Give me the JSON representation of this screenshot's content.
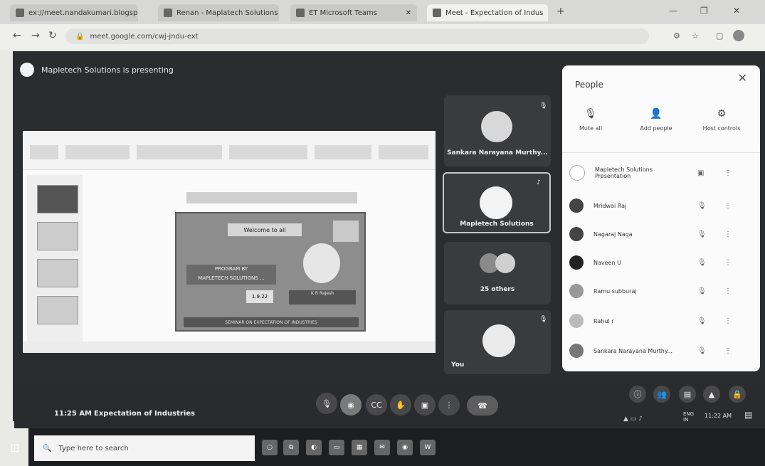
{
  "browser": {
    "tabs": [
      {
        "label": "ex://meet.nandakumari.blogspot.in"
      },
      {
        "label": "Renan - Maplatech Solutions in"
      },
      {
        "label": "ET Microsoft Teams"
      },
      {
        "label": "Meet - Expectation of Indus"
      }
    ],
    "url": "meet.google.com/cwj-jndu-ext"
  },
  "meet": {
    "presenting_banner": "Mapletech Solutions is presenting",
    "slide": {
      "banner": "Welcome to all",
      "presenter_text": "PROGRAM BY\nMAPLETECH SOLUTIONS ...",
      "name_text": "K R Rajesh",
      "date_text": "1.9.22",
      "footer_text": "SEMINAR ON EXPECTATION OF INDUSTRIES"
    },
    "tiles": [
      {
        "name": "Sankara Narayana Murthy..."
      },
      {
        "name": "Mapletech Solutions"
      },
      {
        "name": "25 others"
      },
      {
        "name": "You"
      }
    ],
    "time": "11:25 AM",
    "meeting_title": "Expectation of Industries"
  },
  "people_panel": {
    "title": "People",
    "actions": [
      {
        "label": "Mute all",
        "icon": "mic-off-icon"
      },
      {
        "label": "Add people",
        "icon": "add-person-icon"
      },
      {
        "label": "Host controls",
        "icon": "host-controls-icon"
      }
    ],
    "participants": [
      {
        "name": "Mapletech Solutions\nPresentation"
      },
      {
        "name": "Mridwai Raj"
      },
      {
        "name": "Nagaraj Naga"
      },
      {
        "name": "Naveen U"
      },
      {
        "name": "Ramu subburaj"
      },
      {
        "name": "Rahul r"
      },
      {
        "name": "Sankara Narayana Murthy..."
      }
    ]
  },
  "taskbar": {
    "search_placeholder": "Type here to search",
    "clock": "11:22 AM",
    "lang": "ENG\nIN"
  },
  "colors": {
    "meet_bg": "#2b2c2e",
    "panel_bg": "#fbfbfb",
    "taskbar_bg": "#1d1e20"
  }
}
